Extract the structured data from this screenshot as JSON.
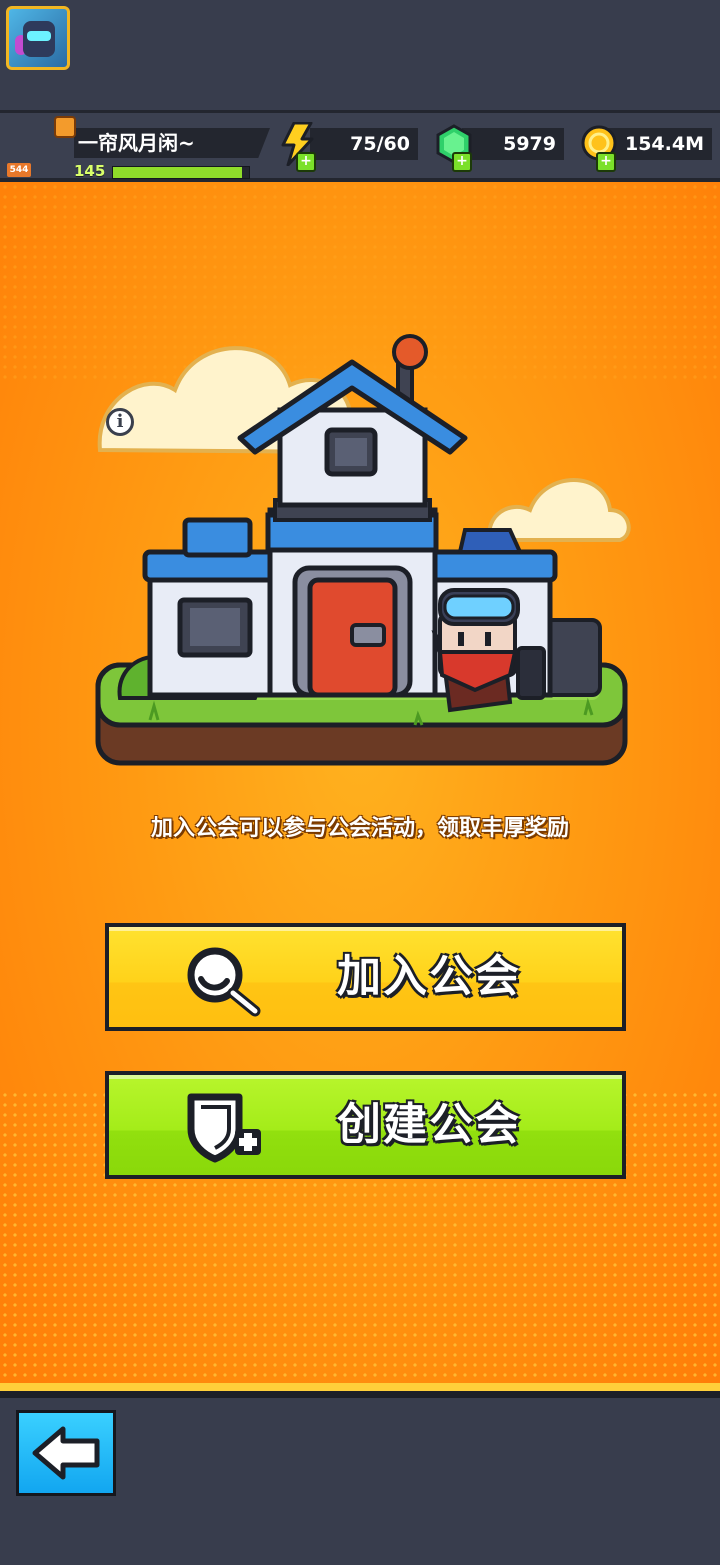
{
  "player": {
    "name": "一帘风月闲~",
    "level": "145",
    "avatar_level": "544",
    "xp_progress": 0.95
  },
  "resources": {
    "energy": {
      "value": "75/60",
      "icon": "lightning-icon"
    },
    "gems": {
      "value": "5979",
      "icon": "green-gem-icon"
    },
    "coins": {
      "value": "154.4M",
      "icon": "gold-coin-icon"
    }
  },
  "guild": {
    "description": "加入公会可以参与公会活动，领取丰厚奖励",
    "join_label": "加入公会",
    "create_label": "创建公会",
    "info_glyph": "i"
  },
  "navigation": {
    "back_icon": "back-arrow-icon"
  },
  "colors": {
    "panel_orange": "#ff9a12",
    "join_yellow": "#ffd21a",
    "create_green": "#a4ec19",
    "back_blue": "#12a6f0",
    "dark_bar": "#383d4d"
  }
}
